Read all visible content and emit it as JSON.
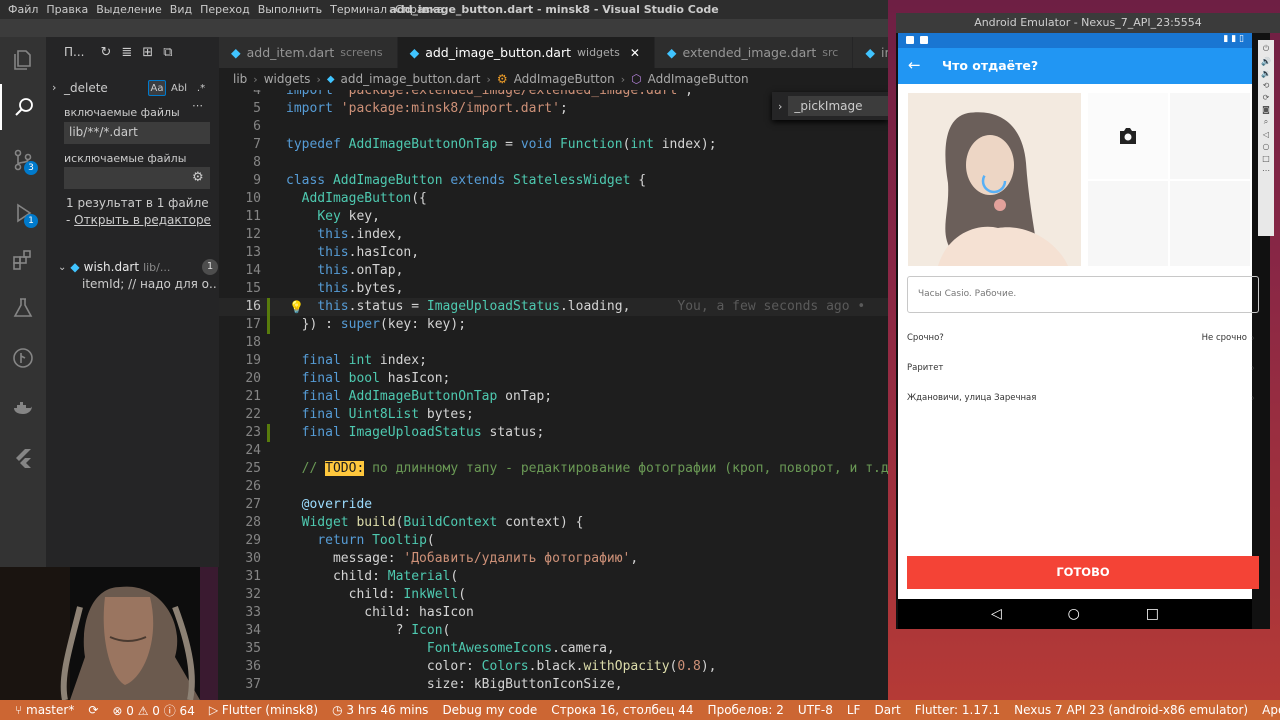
{
  "titlebar": {
    "menu": [
      "Файл",
      "Правка",
      "Выделение",
      "Вид",
      "Переход",
      "Выполнить",
      "Терминал",
      "Справка"
    ],
    "title": "add_image_button.dart - minsk8 - Visual Studio Code"
  },
  "activity_bar": {
    "scm_badge": "3",
    "debug_badge": "1"
  },
  "sidebar": {
    "title": "П...",
    "search_value": "_delete",
    "opt_case": "Aa",
    "opt_word": "Abl",
    "opt_regex": ".*",
    "include_label": "включаемые файлы",
    "include_value": "lib/**/*.dart",
    "exclude_label": "исключаемые файлы",
    "results_text": "1 результат в 1 файле -",
    "open_in_editor": "Открыть в редакторе",
    "file_name": "wish.dart",
    "file_path": "lib/...",
    "file_count": "1",
    "match_text": "itemId; // надо для о..."
  },
  "tabs": [
    {
      "label": "add_item.dart",
      "desc": "screens"
    },
    {
      "label": "add_image_button.dart",
      "desc": "widgets"
    },
    {
      "label": "extended_image.dart",
      "desc": "src"
    },
    {
      "label": "ima",
      "desc": ""
    }
  ],
  "breadcrumb": [
    "lib",
    "widgets",
    "add_image_button.dart",
    "AddImageButton",
    "AddImageButton"
  ],
  "find_widget": {
    "value": "_pickImage"
  },
  "editor": {
    "blame": "You, a few seconds ago •",
    "todo": "TODO:",
    "line_numbers": [
      "4",
      "5",
      "6",
      "7",
      "8",
      "9",
      "10",
      "11",
      "12",
      "13",
      "14",
      "15",
      "16",
      "17",
      "18",
      "19",
      "20",
      "21",
      "22",
      "23",
      "24",
      "25",
      "26",
      "27",
      "28",
      "29",
      "30",
      "31",
      "32",
      "33",
      "34",
      "35",
      "36",
      "37"
    ]
  },
  "statusbar": {
    "branch": "master*",
    "errors": "⊗ 0 ⚠ 0 ⓘ 64",
    "flutter": "Flutter (minsk8)",
    "time": "3 hrs 46 mins",
    "debug_mode": "Debug my code",
    "position": "Строка 16, столбец 44",
    "spaces": "Пробелов: 2",
    "encoding": "UTF-8",
    "eol": "LF",
    "language": "Dart",
    "flutter_version": "Flutter: 1.17.1",
    "device": "Nexus 7 API 23 (android-x86 emulator)",
    "apollo": "Apollo"
  },
  "emulator": {
    "window_title": "Android Emulator - Nexus_7_API_23:5554",
    "app_title": "Что отдаёте?",
    "description_placeholder": "Часы Casio. Рабочие.",
    "options": [
      {
        "label": "Срочно?",
        "value": "Не срочно"
      },
      {
        "label": "Раритет",
        "value": ""
      },
      {
        "label": "Ждановичи, улица Заречная",
        "value": ""
      }
    ],
    "done_button": "ГОТОВО"
  }
}
